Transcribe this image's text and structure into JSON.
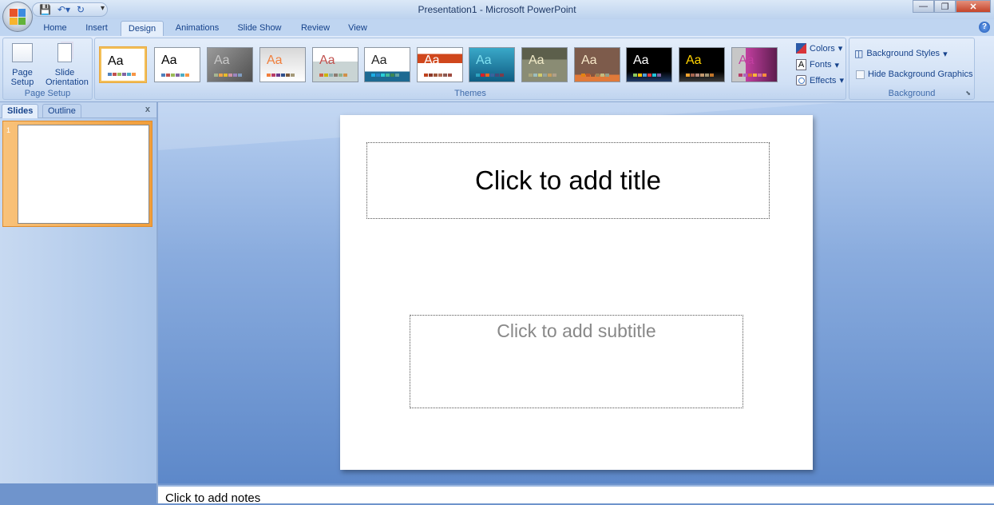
{
  "window": {
    "title": "Presentation1 - Microsoft PowerPoint"
  },
  "ribbon_tabs": [
    "Home",
    "Insert",
    "Design",
    "Animations",
    "Slide Show",
    "Review",
    "View"
  ],
  "active_tab": "Design",
  "page_setup": {
    "page_setup": "Page Setup",
    "slide_orientation": "Slide Orientation",
    "group_label": "Page Setup"
  },
  "themes": {
    "group_label": "Themes",
    "items": [
      {
        "bg": "#ffffff",
        "fg": "#000000",
        "sw": [
          "#4f81bd",
          "#c0504d",
          "#9bbb59",
          "#8064a2",
          "#4bacc6",
          "#f79646"
        ]
      },
      {
        "bg": "#ffffff",
        "fg": "#000000",
        "sw": [
          "#4f81bd",
          "#c0504d",
          "#9bbb59",
          "#8064a2",
          "#4bacc6",
          "#f79646"
        ]
      },
      {
        "bg": "linear-gradient(135deg,#9a9a9a,#505050)",
        "fg": "#c8c8c8",
        "sw": [
          "#a5b592",
          "#f3a447",
          "#e7bc29",
          "#d092a7",
          "#9c85c0",
          "#809ec2"
        ]
      },
      {
        "bg": "linear-gradient(#d8d8d8,#fff)",
        "fg": "#f07f3c",
        "sw": [
          "#f07f3c",
          "#b83d68",
          "#6b3b8c",
          "#2f4f8b",
          "#7b5a3c",
          "#a59a7a"
        ]
      },
      {
        "bg": "linear-gradient(#fff 40%,#c9d4d4 40%)",
        "fg": "#c0504d",
        "sw": [
          "#d16349",
          "#ccb400",
          "#8cadae",
          "#8c7b70",
          "#8fb08c",
          "#d19049"
        ]
      },
      {
        "bg": "linear-gradient(#fff 70%,#1d6a92 70%)",
        "fg": "#222222",
        "sw": [
          "#1cade4",
          "#2683c6",
          "#27ced7",
          "#42ba97",
          "#3e8853",
          "#62a39f"
        ]
      },
      {
        "bg": "linear-gradient(#fff 18%,#d0471c 18%,#d0471c 45%,#fff 45%)",
        "fg": "#ffffff",
        "sw": [
          "#c0421d",
          "#8d3a2b",
          "#a0573a",
          "#b06b53",
          "#8b5a52",
          "#a04b3f"
        ]
      },
      {
        "bg": "linear-gradient(#3aa8c8,#0f5d83)",
        "fg": "#7fe0f0",
        "sw": [
          "#2da2bf",
          "#da1f28",
          "#eb641b",
          "#39639d",
          "#474b78",
          "#7d3c4a"
        ]
      },
      {
        "bg": "linear-gradient(#5c5f4b 35%,#8a8c74 35%)",
        "fg": "#f2ebc8",
        "sw": [
          "#a9a57c",
          "#9cbebd",
          "#d2cb6c",
          "#95a39d",
          "#c89f5d",
          "#b1a089"
        ]
      },
      {
        "bg": "linear-gradient(#7d5b4b 80%,#e07a3a 80%)",
        "fg": "#f7e7c8",
        "sw": [
          "#e48312",
          "#bd582c",
          "#865640",
          "#9b8357",
          "#c2bc80",
          "#94a088"
        ]
      },
      {
        "bg": "linear-gradient(#000 70%,#1f3a66)",
        "fg": "#ffffff",
        "sw": [
          "#8ac75c",
          "#ffc000",
          "#4c9ed9",
          "#e43a3a",
          "#23c4d8",
          "#8064a2"
        ]
      },
      {
        "bg": "linear-gradient(#000 70%,#3a3a3a)",
        "fg": "#ffd200",
        "sw": [
          "#f0a22e",
          "#a5644e",
          "#b58b80",
          "#c3986d",
          "#a19574",
          "#c17529"
        ]
      },
      {
        "bg": "linear-gradient(90deg,#c7c7c7 30%,#c23fa0 30%,#5e1d4f)",
        "fg": "#c23fa0",
        "sw": [
          "#b83d68",
          "#ac66bb",
          "#de6c36",
          "#f9b639",
          "#cf6da4",
          "#fa8d3d"
        ]
      }
    ],
    "colors": "Colors",
    "fonts": "Fonts",
    "effects": "Effects"
  },
  "background": {
    "styles": "Background Styles",
    "hide_graphics": "Hide Background Graphics",
    "hide_graphics_checked": false,
    "group_label": "Background"
  },
  "left_panel": {
    "tabs": [
      "Slides",
      "Outline"
    ],
    "active": "Slides",
    "close": "x",
    "slide_number": "1"
  },
  "slide": {
    "title_placeholder": "Click to add title",
    "subtitle_placeholder": "Click to add subtitle"
  },
  "notes": {
    "placeholder": "Click to add notes"
  }
}
